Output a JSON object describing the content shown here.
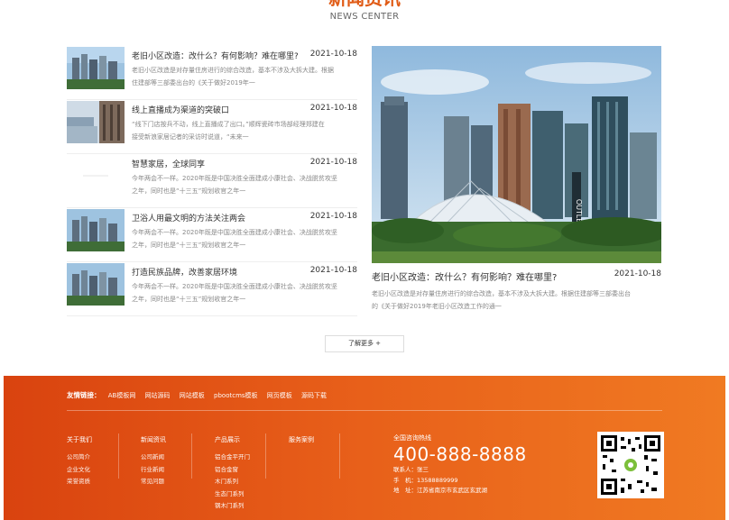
{
  "section": {
    "title": "新闻资讯",
    "subtitle": "NEWS CENTER"
  },
  "news": [
    {
      "title": "老旧小区改造：改什么？有何影响？难在哪里?",
      "date": "2021-10-18",
      "desc_line1": "老旧小区改造是对存量住房进行的综合改造，基本不涉及大拆大建。根据",
      "desc_line2": "住建部等三部委出台的《关于做好2019年一"
    },
    {
      "title": "线上直播成为渠道的突破口",
      "date": "2021-10-18",
      "desc_line1": "“线下门店按兵不动，线上直播成了出口。”顺辉瓷砖市场部经理郑建在",
      "desc_line2": "接受新浪家居记者的采访时说道，“未来一"
    },
    {
      "title": "智慧家居，全球同享",
      "date": "2021-10-18",
      "desc_line1": "今年两会不一样。2020年既是中国决胜全面建成小康社会、决战脱贫攻坚",
      "desc_line2": "之年，同时也是“十三五”规划收官之年一"
    },
    {
      "title": "卫浴人用最文明的方法关注两会",
      "date": "2021-10-18",
      "desc_line1": "今年两会不一样。2020年既是中国决胜全面建成小康社会、决战脱贫攻坚",
      "desc_line2": "之年，同时也是“十三五”规划收官之年一"
    },
    {
      "title": "打造民族品牌，改善家居环境",
      "date": "2021-10-18",
      "desc_line1": "今年两会不一样。2020年既是中国决胜全面建成小康社会、决战脱贫攻坚",
      "desc_line2": "之年，同时也是“十三五”规划收官之年一"
    }
  ],
  "feature": {
    "title": "老旧小区改造：改什么？有何影响？难在哪里?",
    "date": "2021-10-18",
    "desc_line1": "老旧小区改造是对存量住房进行的综合改造，基本不涉及大拆大建。根据住建部等三部委出台",
    "desc_line2": "的《关于做好2019年老旧小区改造工作的通一",
    "sign_text": "OUTLET"
  },
  "more_button": "了解更多 +",
  "footer": {
    "links_label": "友情链接：",
    "links": [
      "AB模板网",
      "网站源码",
      "网站模板",
      "pbootcms模板",
      "网页模板",
      "源码下载"
    ],
    "columns": [
      {
        "head": "关于我们",
        "items": [
          "公司简介",
          "企业文化",
          "荣誉资质"
        ]
      },
      {
        "head": "新闻资讯",
        "items": [
          "公司新闻",
          "行业新闻",
          "常见问题"
        ]
      },
      {
        "head": "产品展示",
        "items": [
          "铝合金平开门",
          "铝合金窗",
          "木门系列",
          "生态门系列",
          "钢木门系列"
        ]
      },
      {
        "head": "服务案例",
        "items": []
      }
    ],
    "contact": {
      "label": "全国咨询热线",
      "phone": "400-888-8888",
      "person": "联系人：张三",
      "mobile": "手　机：13588889999",
      "address": "地　址：江苏省南京市玄武区玄武湖"
    }
  },
  "colors": {
    "accent": "#e05a14",
    "footer_start": "#d9430f",
    "footer_end": "#f07a22"
  }
}
